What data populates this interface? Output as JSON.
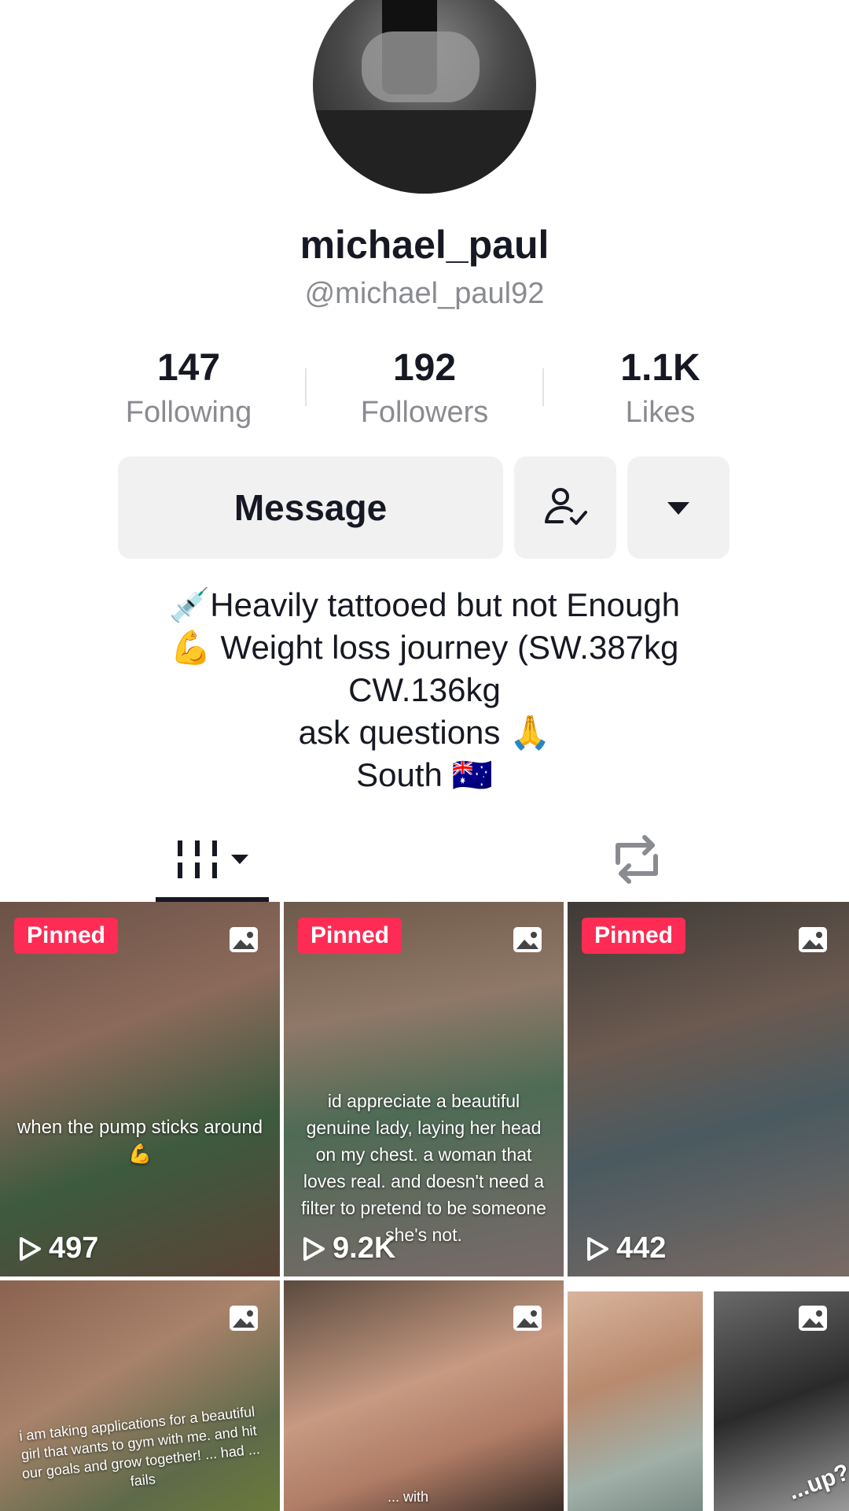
{
  "profile": {
    "display_name": "michael_paul",
    "handle": "@michael_paul92"
  },
  "stats": [
    {
      "value": "147",
      "label": "Following"
    },
    {
      "value": "192",
      "label": "Followers"
    },
    {
      "value": "1.1K",
      "label": "Likes"
    }
  ],
  "actions": {
    "message_label": "Message",
    "following_icon": "person-check-icon",
    "more_icon": "caret-down-icon"
  },
  "bio": {
    "line1": "💉Heavily tattooed but not Enough",
    "line2": "💪 Weight loss journey (SW.387kg",
    "line3": "CW.136kg",
    "line4": "ask questions 🙏",
    "line5": "South 🇦🇺"
  },
  "tabs": {
    "videos_icon": "grid-icon",
    "reposts_icon": "repost-icon"
  },
  "videos": [
    {
      "pinned": "Pinned",
      "caption": "when the pump sticks around 💪",
      "views": "497"
    },
    {
      "pinned": "Pinned",
      "caption": "id appreciate a beautiful genuine lady, laying her head on my chest. a woman that loves real. and doesn't need a filter to pretend to be someone she's not.",
      "views": "9.2K"
    },
    {
      "pinned": "Pinned",
      "caption": "",
      "views": "442"
    },
    {
      "pinned": "",
      "caption": "i am taking applications for a beautiful girl that wants to gym with me. and hit our goals and grow together! ... had ... fails",
      "views": ""
    },
    {
      "pinned": "",
      "caption": "... with",
      "views": ""
    },
    {
      "pinned": "",
      "caption": "...up?",
      "views": ""
    }
  ],
  "colors": {
    "accent": "#fe2c55",
    "text": "#161823",
    "muted": "#8a8b91",
    "button_bg": "#f1f1f2"
  }
}
